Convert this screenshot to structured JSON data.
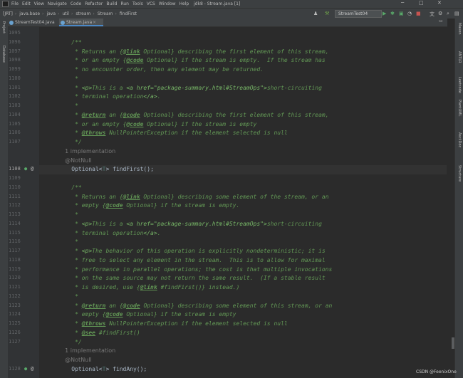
{
  "menubar": {
    "items": [
      "File",
      "Edit",
      "View",
      "Navigate",
      "Code",
      "Refactor",
      "Build",
      "Run",
      "Tools",
      "VCS",
      "Window",
      "Help"
    ],
    "title": "jdk8 - Stream.java [1]"
  },
  "navbar": {
    "crumbs": [
      "[JRT]",
      "java.base",
      "java",
      "util",
      "stream",
      "Stream",
      "findFirst"
    ],
    "run_config": "StreamTest04"
  },
  "tabs": [
    {
      "label": "StreamTest04.java",
      "active": false
    },
    {
      "label": "Stream.java",
      "active": true
    }
  ],
  "left_tools": [
    "Project",
    "Database"
  ],
  "right_tools": [
    "Maven",
    "ANTLR",
    "Leetcode",
    "PlantUML",
    "AsciiDoc",
    "Structure"
  ],
  "colors": {
    "comment": "#629755",
    "code": "#a9b7c6",
    "annotation": "#bbb529",
    "background": "#2b2b2b"
  },
  "editor": {
    "lines": [
      {
        "num": "1095",
        "text": ""
      },
      {
        "num": "1096",
        "text": "    /**"
      },
      {
        "num": "1097",
        "text": "     * Returns an {@link Optional} describing the first element of this stream,"
      },
      {
        "num": "1098",
        "text": "     * or an empty {@code Optional} if the stream is empty.  If the stream has"
      },
      {
        "num": "1099",
        "text": "     * no encounter order, then any element may be returned."
      },
      {
        "num": "1100",
        "text": "     *"
      },
      {
        "num": "1101",
        "text": "     * <p>This is a <a href=\"package-summary.html#StreamOps\">short-circuiting"
      },
      {
        "num": "1102",
        "text": "     * terminal operation</a>."
      },
      {
        "num": "1103",
        "text": "     *"
      },
      {
        "num": "1104",
        "text": "     * @return an {@code Optional} describing the first element of this stream,"
      },
      {
        "num": "1105",
        "text": "     * or an empty {@code Optional} if the stream is empty"
      },
      {
        "num": "1106",
        "text": "     * @throws NullPointerException if the element selected is null"
      },
      {
        "num": "1107",
        "text": "     */"
      },
      {
        "num": "",
        "text": "    1 implementation"
      },
      {
        "num": "",
        "text": "    @NotNull"
      },
      {
        "num": "1108",
        "text": "    Optional<T> findFirst();"
      },
      {
        "num": "1109",
        "text": ""
      },
      {
        "num": "1110",
        "text": "    /**"
      },
      {
        "num": "1111",
        "text": "     * Returns an {@link Optional} describing some element of the stream, or an"
      },
      {
        "num": "1112",
        "text": "     * empty {@code Optional} if the stream is empty."
      },
      {
        "num": "1113",
        "text": "     *"
      },
      {
        "num": "1114",
        "text": "     * <p>This is a <a href=\"package-summary.html#StreamOps\">short-circuiting"
      },
      {
        "num": "1115",
        "text": "     * terminal operation</a>."
      },
      {
        "num": "1116",
        "text": "     *"
      },
      {
        "num": "1117",
        "text": "     * <p>The behavior of this operation is explicitly nondeterministic; it is"
      },
      {
        "num": "1118",
        "text": "     * free to select any element in the stream.  This is to allow for maximal"
      },
      {
        "num": "1119",
        "text": "     * performance in parallel operations; the cost is that multiple invocations"
      },
      {
        "num": "1120",
        "text": "     * on the same source may not return the same result.  (If a stable result"
      },
      {
        "num": "1121",
        "text": "     * is desired, use {@link #findFirst()} instead.)"
      },
      {
        "num": "1122",
        "text": "     *"
      },
      {
        "num": "1123",
        "text": "     * @return an {@code Optional} describing some element of this stream, or an"
      },
      {
        "num": "1124",
        "text": "     * empty {@code Optional} if the stream is empty"
      },
      {
        "num": "1125",
        "text": "     * @throws NullPointerException if the element selected is null"
      },
      {
        "num": "1126",
        "text": "     * @see #findFirst()"
      },
      {
        "num": "1127",
        "text": "     */"
      },
      {
        "num": "",
        "text": "    1 implementation"
      },
      {
        "num": "",
        "text": "    @NotNull"
      },
      {
        "num": "1128",
        "text": "    Optional<T> findAny();"
      }
    ]
  },
  "watermark": "CSDN @FeenixOne"
}
